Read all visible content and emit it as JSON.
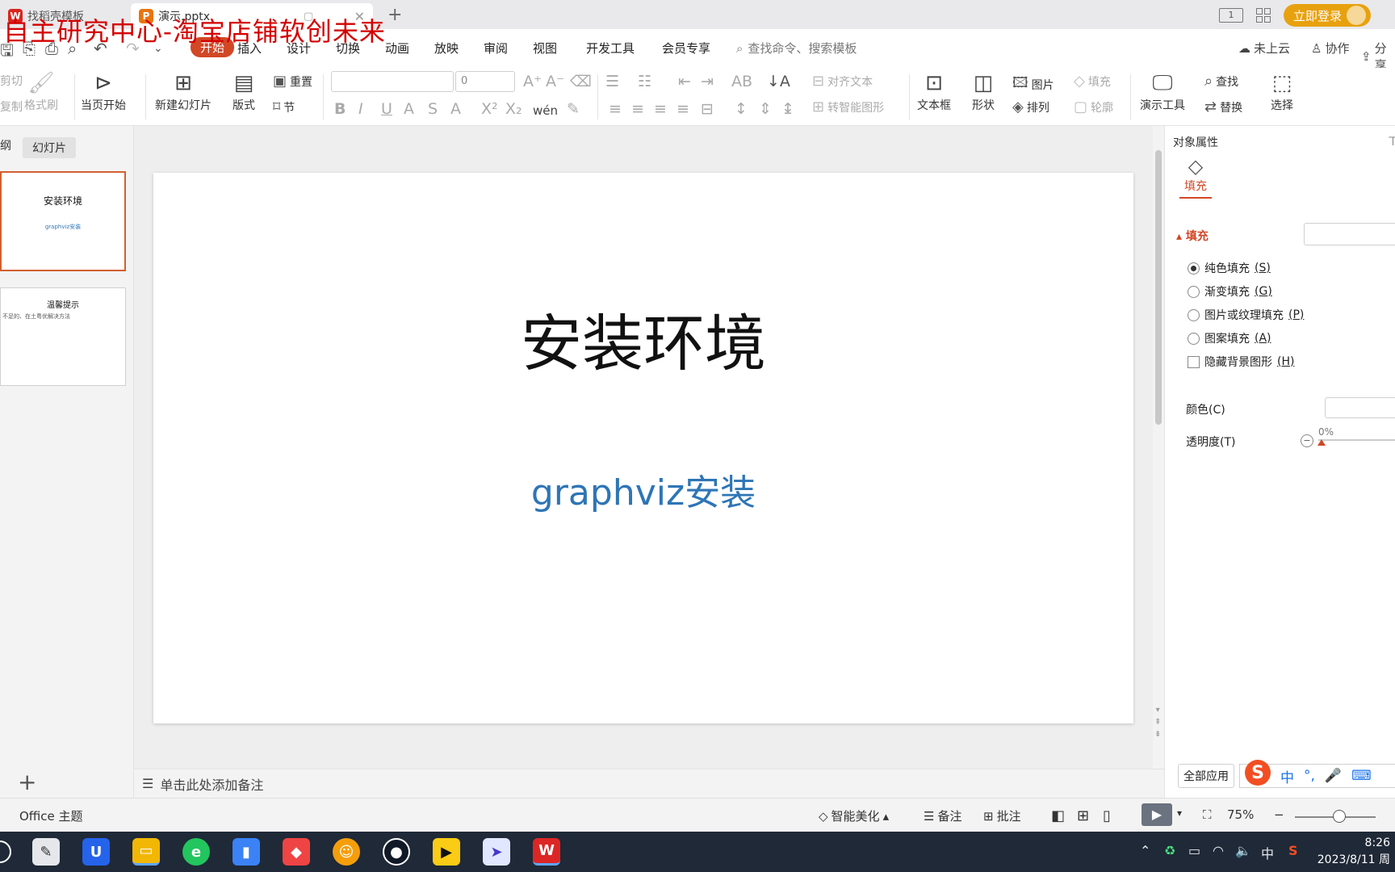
{
  "watermark": "自主研究中心-淘宝店铺软创未来",
  "tabs": [
    {
      "label": "找稻壳模板",
      "logo": "wps-logo-icon"
    },
    {
      "label": "演示.pptx",
      "logo": "pptx-logo-icon"
    }
  ],
  "title_right": {
    "login": "立即登录",
    "page_indicator": "1"
  },
  "menu": {
    "items": [
      "开始",
      "插入",
      "设计",
      "切换",
      "动画",
      "放映",
      "审阅",
      "视图",
      "开发工具",
      "会员专享"
    ],
    "search_placeholder": "查找命令、搜索模板",
    "cloud": "未上云",
    "collab": "协作",
    "share": "分享"
  },
  "ribbon": {
    "cut": "剪切",
    "copy": "复制",
    "format_painter": "格式刷",
    "play_from_current": "当页开始",
    "new_slide": "新建幻灯片",
    "layout": "版式",
    "reset": "重置",
    "section": "节",
    "font_size": "0",
    "align_text": "对齐文本",
    "smartart": "转智能图形",
    "textbox": "文本框",
    "shape": "形状",
    "picture": "图片",
    "arrange": "排列",
    "fill": "填充",
    "outline": "轮廓",
    "demo_tools": "演示工具",
    "find": "查找",
    "replace": "替换",
    "select": "选择"
  },
  "left_pane": {
    "outline_tab": "纲",
    "slides_tab": "幻灯片",
    "slides": [
      {
        "title": "安装环境",
        "subtitle": "graphviz安装"
      },
      {
        "title": "温馨提示",
        "subtitle": "不足的、在土粤优解决方法"
      }
    ]
  },
  "slide": {
    "title": "安装环境",
    "subtitle": "graphviz安装"
  },
  "notes_placeholder": "单击此处添加备注",
  "props": {
    "title": "对象属性",
    "tab": "填充",
    "section": "填充",
    "options": [
      {
        "label": "纯色填充",
        "key": "S",
        "type": "radio",
        "checked": true
      },
      {
        "label": "渐变填充",
        "key": "G",
        "type": "radio",
        "checked": false
      },
      {
        "label": "图片或纹理填充",
        "key": "P",
        "type": "radio",
        "checked": false
      },
      {
        "label": "图案填充",
        "key": "A",
        "type": "radio",
        "checked": false
      },
      {
        "label": "隐藏背景图形",
        "key": "H",
        "type": "checkbox",
        "checked": false
      }
    ],
    "color_label": "颜色(C)",
    "transparency_label": "透明度(T)",
    "transparency_value": "0%",
    "apply_all": "全部应用",
    "ime_chars": [
      "中",
      "°,",
      "🎤",
      "⌨"
    ]
  },
  "status": {
    "theme": "Office 主题",
    "beautify": "智能美化",
    "notes": "备注",
    "comments": "批注",
    "zoom": "75%",
    "zoom_level": 0.55
  },
  "taskbar": {
    "time": "8:26",
    "date": "2023/8/11 周"
  },
  "colors": {
    "accent": "#d24726",
    "slide_subtitle": "#2e75b6",
    "login": "#e8a10e"
  }
}
